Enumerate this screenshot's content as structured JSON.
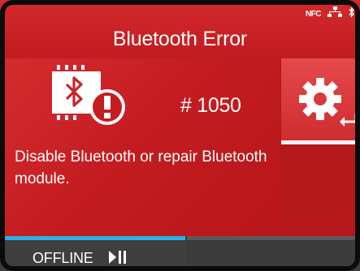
{
  "header": {
    "title": "Bluetooth Error",
    "status_icons": [
      "nfc-icon",
      "network-icon",
      "bluetooth-status-icon"
    ],
    "nfc_label": "NFC"
  },
  "error": {
    "code": "# 1050",
    "message": "Disable Bluetooth or repair Bluetooth module.",
    "icon": "bluetooth-module-error-icon"
  },
  "side": {
    "settings_icon": "gear-icon",
    "enter_icon": "enter-icon"
  },
  "footer": {
    "status_label": "OFFLINE",
    "play_pause_icon": "play-pause-icon"
  },
  "colors": {
    "background_red": "#c61c20",
    "selected_red": "#e6494b",
    "footer_gray": "#3c3c3c",
    "accent_blue": "#29b1e8",
    "text_white": "#ffffff"
  }
}
